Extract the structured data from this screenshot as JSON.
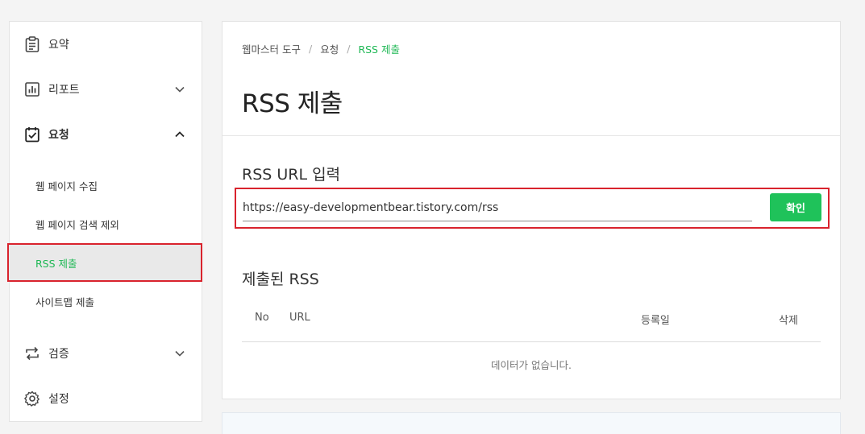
{
  "sidebar": {
    "items": [
      {
        "label": "요약",
        "icon": "clipboard-icon"
      },
      {
        "label": "리포트",
        "icon": "chart-icon"
      },
      {
        "label": "요청",
        "icon": "calendar-check-icon"
      },
      {
        "label": "검증",
        "icon": "repeat-icon"
      },
      {
        "label": "설정",
        "icon": "gear-icon"
      }
    ],
    "sub_items": [
      "웹 페이지 수집",
      "웹 페이지 검색 제외",
      "RSS 제출",
      "사이트맵 제출"
    ]
  },
  "breadcrumb": {
    "items": [
      "웹마스터 도구",
      "요청",
      "RSS 제출"
    ],
    "separator": "/"
  },
  "page_title": "RSS 제출",
  "rss_input": {
    "label": "RSS URL 입력",
    "value": "https://easy-developmentbear.tistory.com/rss",
    "button": "확인"
  },
  "submitted": {
    "title": "제출된 RSS",
    "columns": [
      "No",
      "URL",
      "등록일",
      "삭제"
    ],
    "empty_message": "데이터가 없습니다."
  },
  "colors": {
    "accent": "#1fc25a",
    "highlight": "#d9232d"
  }
}
